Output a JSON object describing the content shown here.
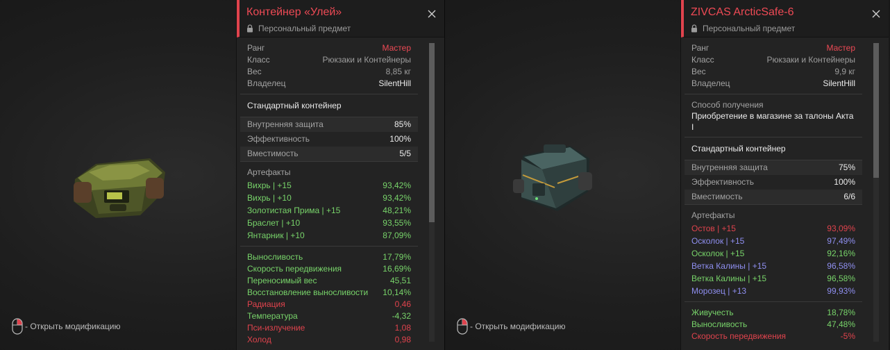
{
  "left": {
    "hint": "- Открыть модификацию",
    "item": {
      "title": "Контейнер «Улей»",
      "subtitle": "Персональный предмет",
      "rows": [
        {
          "k": "Ранг",
          "v": "Мастер",
          "style": "red"
        },
        {
          "k": "Класс",
          "v": "Рюкзаки и Контейнеры",
          "style": ""
        },
        {
          "k": "Вес",
          "v": "8,85 кг",
          "style": ""
        },
        {
          "k": "Владелец",
          "v": "SilentHill",
          "style": "hi"
        }
      ],
      "type": "Стандартный контейнер",
      "stats": [
        {
          "k": "Внутренняя защита",
          "v": "85%"
        },
        {
          "k": "Эффективность",
          "v": "100%"
        },
        {
          "k": "Вместимость",
          "v": "5/5"
        }
      ],
      "artifacts_title": "Артефакты",
      "artifacts": [
        {
          "name": "Вихрь | +15",
          "val": "93,42%",
          "color": "green"
        },
        {
          "name": "Вихрь | +10",
          "val": "93,42%",
          "color": "green"
        },
        {
          "name": "Золотистая Прима | +15",
          "val": "48,21%",
          "color": "green"
        },
        {
          "name": "Браслет | +10",
          "val": "93,55%",
          "color": "green"
        },
        {
          "name": "Янтарник | +10",
          "val": "87,09%",
          "color": "green"
        }
      ],
      "bonuses": [
        {
          "name": "Выносливость",
          "val": "17,79%",
          "color": "green"
        },
        {
          "name": "Скорость передвижения",
          "val": "16,69%",
          "color": "green"
        },
        {
          "name": "Переносимый вес",
          "val": "45,51",
          "color": "green"
        },
        {
          "name": "Восстановление выносливости",
          "val": "10,14%",
          "color": "green"
        },
        {
          "name": "Радиация",
          "val": "0,46",
          "color": "red"
        },
        {
          "name": "Температура",
          "val": "-4,32",
          "color": "green"
        },
        {
          "name": "Пси-излучение",
          "val": "1,08",
          "color": "red"
        },
        {
          "name": "Холод",
          "val": "0,98",
          "color": "red"
        }
      ]
    },
    "scroll": {
      "thumb_fraction": 0.6
    }
  },
  "right": {
    "hint": "- Открыть модификацию",
    "item": {
      "title": "ZIVCAS ArcticSafe-6",
      "subtitle": "Персональный предмет",
      "rows": [
        {
          "k": "Ранг",
          "v": "Мастер",
          "style": "red"
        },
        {
          "k": "Класс",
          "v": "Рюкзаки и Контейнеры",
          "style": ""
        },
        {
          "k": "Вес",
          "v": "9,9 кг",
          "style": ""
        },
        {
          "k": "Владелец",
          "v": "SilentHill",
          "style": "hi"
        }
      ],
      "source_label": "Способ получения",
      "source_text": "Приобретение в магазине за талоны Акта I",
      "type": "Стандартный контейнер",
      "stats": [
        {
          "k": "Внутренняя защита",
          "v": "75%"
        },
        {
          "k": "Эффективность",
          "v": "100%"
        },
        {
          "k": "Вместимость",
          "v": "6/6"
        }
      ],
      "artifacts_title": "Артефакты",
      "artifacts": [
        {
          "name": "Остов | +15",
          "val": "93,09%",
          "color": "red"
        },
        {
          "name": "Осколок | +15",
          "val": "97,49%",
          "color": "blue"
        },
        {
          "name": "Осколок | +15",
          "val": "92,16%",
          "color": "green"
        },
        {
          "name": "Ветка Калины | +15",
          "val": "96,58%",
          "color": "blue"
        },
        {
          "name": "Ветка Калины | +15",
          "val": "96,58%",
          "color": "green"
        },
        {
          "name": "Морозец | +13",
          "val": "99,93%",
          "color": "blue"
        }
      ],
      "bonuses": [
        {
          "name": "Живучесть",
          "val": "18,78%",
          "color": "green"
        },
        {
          "name": "Выносливость",
          "val": "47,48%",
          "color": "green"
        },
        {
          "name": "Скорость передвижения",
          "val": "-5%",
          "color": "red"
        }
      ]
    },
    "scroll": {
      "thumb_fraction": 0.45
    }
  }
}
